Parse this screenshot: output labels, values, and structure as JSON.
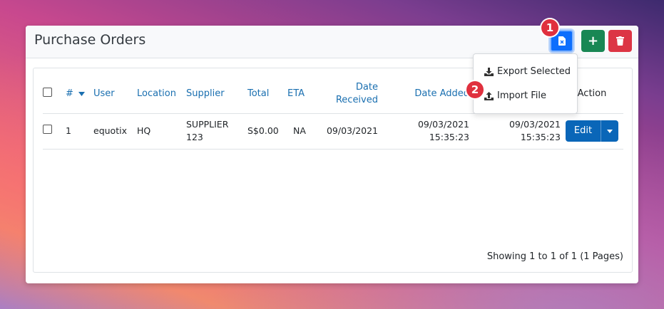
{
  "header": {
    "title": "Purchase Orders"
  },
  "toolbar": {
    "add_label": "+"
  },
  "table": {
    "columns": {
      "num": "#",
      "user": "User",
      "location": "Location",
      "supplier": "Supplier",
      "total": "Total",
      "eta": "ETA",
      "date_received_1": "Date",
      "date_received_2": "Received",
      "date_added": "Date Added",
      "date_updated": "",
      "action": "Action"
    },
    "rows": [
      {
        "num": "1",
        "user": "equotix",
        "location": "HQ",
        "supplier_1": "SUPPLIER",
        "supplier_2": "123",
        "total": "S$0.00",
        "eta": "NA",
        "date_received": "09/03/2021",
        "date_added_1": "09/03/2021",
        "date_added_2": "15:35:23",
        "date_updated_1": "09/03/2021",
        "date_updated_2": "15:35:23",
        "edit_label": "Edit"
      }
    ]
  },
  "dropdown": {
    "export_selected": "Export Selected",
    "import_file": "Import File"
  },
  "footer": {
    "showing": "Showing 1 to 1 of 1 (1 Pages)"
  },
  "markers": {
    "one": "1",
    "two": "2"
  },
  "colors": {
    "primary": "#0d6efd",
    "success": "#198754",
    "danger": "#dc3545",
    "link": "#1a6fb0",
    "marker": "#e0303e"
  }
}
